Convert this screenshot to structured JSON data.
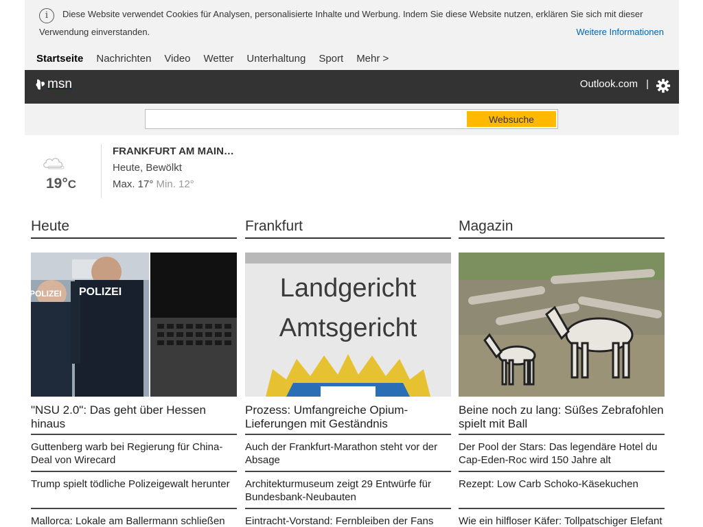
{
  "cookie": {
    "text": "Diese Website verwendet Cookies für Analysen, personalisierte Inhalte und Werbung. Indem Sie diese Website nutzen, erklären Sie sich mit dieser Verwendung einverstanden.",
    "more_link": "Weitere Informationen"
  },
  "nav": {
    "items": [
      "Startseite",
      "Nachrichten",
      "Video",
      "Wetter",
      "Unterhaltung",
      "Sport",
      "Mehr >"
    ]
  },
  "header": {
    "brand": "msn",
    "outlook": "Outlook.com",
    "separator": "|"
  },
  "search": {
    "value": "",
    "button": "Websuche"
  },
  "weather": {
    "icon": "cloud-icon",
    "temp": "19°",
    "unit": "C",
    "city": "FRANKFURT AM MAIN…",
    "condition": "Heute, Bewölkt",
    "max": "Max. 17°",
    "min": "Min. 12°"
  },
  "columns": [
    {
      "title": "Heute",
      "headline": "\"NSU 2.0\": Das geht über Hessen hinaus",
      "items": [
        "Guttenberg warb bei Regierung für China-Deal von Wirecard",
        "Trump spielt tödliche Polizeigewalt herunter",
        "Mallorca: Lokale am Ballermann schließen"
      ]
    },
    {
      "title": "Frankfurt",
      "headline": "Prozess: Umfangreiche Opium-Lieferungen mit Geständnis",
      "items": [
        "Auch der Frankfurt-Marathon steht vor der Absage",
        "Architekturmuseum zeigt 29 Entwürfe für Bundesbank-Neubauten",
        "Eintracht-Vorstand: Fernbleiben der Fans"
      ]
    },
    {
      "title": "Magazin",
      "headline": "Beine noch zu lang: Süßes Zebrafohlen spielt mit Ball",
      "items": [
        "Der Pool der Stars: Das legendäre Hotel du Cap-Eden-Roc wird 150 Jahre alt",
        "Rezept: Low Carb Schoko-Käsekuchen",
        "Wie ein hilfloser Käfer: Tollpatschiger Elefant"
      ]
    }
  ],
  "images": {
    "heute_text": "POLIZEI",
    "frankfurt_line1": "Landgericht",
    "frankfurt_line2": "Amtsgericht"
  }
}
